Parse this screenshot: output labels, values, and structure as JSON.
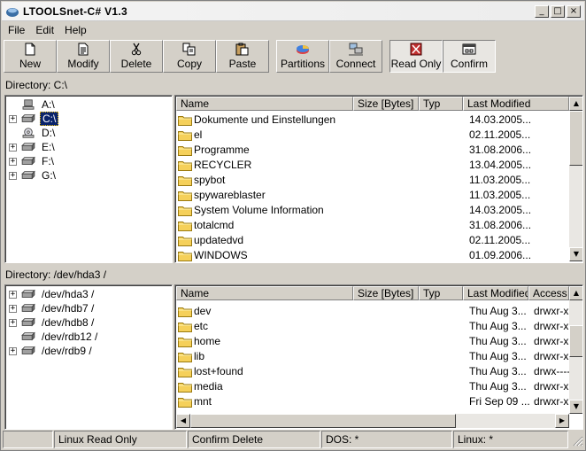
{
  "window": {
    "title": "LTOOLSnet-C# V1.3",
    "minimize": "_",
    "maximize": "□",
    "close": "×"
  },
  "menu": [
    "File",
    "Edit",
    "Help"
  ],
  "toolbar": {
    "new": "New",
    "modify": "Modify",
    "delete": "Delete",
    "copy": "Copy",
    "paste": "Paste",
    "partitions": "Partitions",
    "connect": "Connect",
    "read_only": "Read Only",
    "confirm": "Confirm"
  },
  "top": {
    "directory_label": "Directory: C:\\",
    "tree": [
      {
        "label": "A:\\",
        "expander": ""
      },
      {
        "label": "C:\\",
        "expander": "+",
        "selected": true
      },
      {
        "label": "D:\\",
        "expander": ""
      },
      {
        "label": "E:\\",
        "expander": "+"
      },
      {
        "label": "F:\\",
        "expander": "+"
      },
      {
        "label": "G:\\",
        "expander": "+"
      }
    ],
    "columns": [
      "Name",
      "Size [Bytes]",
      "Typ",
      "Last Modified"
    ],
    "rows": [
      {
        "name": "Dokumente und Einstellungen",
        "modified": "14.03.2005..."
      },
      {
        "name": "el",
        "modified": "02.11.2005..."
      },
      {
        "name": "Programme",
        "modified": "31.08.2006..."
      },
      {
        "name": "RECYCLER",
        "modified": "13.04.2005..."
      },
      {
        "name": "spybot",
        "modified": "11.03.2005..."
      },
      {
        "name": "spywareblaster",
        "modified": "11.03.2005..."
      },
      {
        "name": "System Volume Information",
        "modified": "14.03.2005..."
      },
      {
        "name": "totalcmd",
        "modified": "31.08.2006..."
      },
      {
        "name": "updatedvd",
        "modified": "02.11.2005..."
      },
      {
        "name": "WINDOWS",
        "modified": "01.09.2006..."
      }
    ]
  },
  "bottom": {
    "directory_label": "Directory: /dev/hda3 /",
    "tree": [
      {
        "label": "/dev/hda3 /",
        "expander": "+"
      },
      {
        "label": "/dev/hdb7 /",
        "expander": "+"
      },
      {
        "label": "/dev/hdb8 /",
        "expander": "+"
      },
      {
        "label": "/dev/rdb12 /",
        "expander": ""
      },
      {
        "label": "/dev/rdb9 /",
        "expander": "+"
      }
    ],
    "columns": [
      "Name",
      "Size [Bytes]",
      "Typ",
      "Last Modified",
      "Access"
    ],
    "rows": [
      {
        "name": "dev",
        "modified": "Thu Aug 3...",
        "access": "drwxr-xr-"
      },
      {
        "name": "etc",
        "modified": "Thu Aug 3...",
        "access": "drwxr-xr-"
      },
      {
        "name": "home",
        "modified": "Thu Aug 3...",
        "access": "drwxr-xr-"
      },
      {
        "name": "lib",
        "modified": "Thu Aug 3...",
        "access": "drwxr-xr-"
      },
      {
        "name": "lost+found",
        "modified": "Thu Aug 3...",
        "access": "drwx------"
      },
      {
        "name": "media",
        "modified": "Thu Aug 3...",
        "access": "drwxr-xr-"
      },
      {
        "name": "mnt",
        "modified": "Fri Sep 09 ...",
        "access": "drwxr-xr-"
      }
    ]
  },
  "status": {
    "left": "",
    "linux_read_only": "Linux Read Only",
    "confirm_delete": "Confirm Delete",
    "dos": "DOS: *",
    "linux": "Linux: *"
  },
  "colors": {
    "selection": "#0a246a",
    "folder": "#f5d05a",
    "face": "#d4d0c8"
  }
}
